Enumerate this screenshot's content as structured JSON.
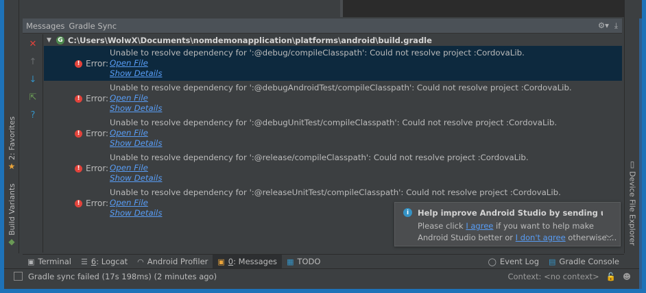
{
  "panel": {
    "title": "Messages",
    "subtitle": "Gradle Sync"
  },
  "tree": {
    "root_path": "C:\\Users\\WolwX\\Documents\\nomdemonapplication\\platforms\\android\\build.gradle",
    "root_icon": "G",
    "messages": [
      {
        "text": "Unable to resolve dependency for ':@debug/compileClasspath': Could not resolve project :CordovaLib.",
        "level": "Error:",
        "open_file": "Open File",
        "show_details": "Show Details",
        "selected": true
      },
      {
        "text": "Unable to resolve dependency for ':@debugAndroidTest/compileClasspath': Could not resolve project :CordovaLib.",
        "level": "Error:",
        "open_file": "Open File",
        "show_details": "Show Details",
        "selected": false
      },
      {
        "text": "Unable to resolve dependency for ':@debugUnitTest/compileClasspath': Could not resolve project :CordovaLib.",
        "level": "Error:",
        "open_file": "Open File",
        "show_details": "Show Details",
        "selected": false
      },
      {
        "text": "Unable to resolve dependency for ':@release/compileClasspath': Could not resolve project :CordovaLib.",
        "level": "Error:",
        "open_file": "Open File",
        "show_details": "Show Details",
        "selected": false
      },
      {
        "text": "Unable to resolve dependency for ':@releaseUnitTest/compileClasspath': Could not resolve project :CordovaLib.",
        "level": "Error:",
        "open_file": "Open File",
        "show_details": "Show Details",
        "selected": false
      }
    ]
  },
  "notification": {
    "title": "Help improve Android Studio by sending usage st",
    "line1_pre": "Please click ",
    "line1_link": "I agree",
    "line1_post": " if you want to help make",
    "line2_pre": "Android Studio better or ",
    "line2_link": "I don't agree",
    "line2_post": " otherwise...."
  },
  "left_strip": {
    "favorites": "2: Favorites",
    "build_variants": "Build Variants"
  },
  "right_strip": {
    "device_file_explorer": "Device File Explorer"
  },
  "bottom_tabs": {
    "terminal": "Terminal",
    "logcat_num": "6",
    "logcat_label": ": Logcat",
    "profiler": "Android Profiler",
    "messages_num": "0",
    "messages_label": ": Messages",
    "todo": "TODO",
    "event_log": "Event Log",
    "gradle_console": "Gradle Console"
  },
  "status_bar": {
    "text": "Gradle sync failed (17s 198ms) (2 minutes ago)",
    "context": "Context: <no context>"
  },
  "colors": {
    "panel_bg": "#3c3f41",
    "selection": "#0d293e",
    "link": "#589df6",
    "error": "#e3433b",
    "window_frame": "#1e72b8"
  }
}
